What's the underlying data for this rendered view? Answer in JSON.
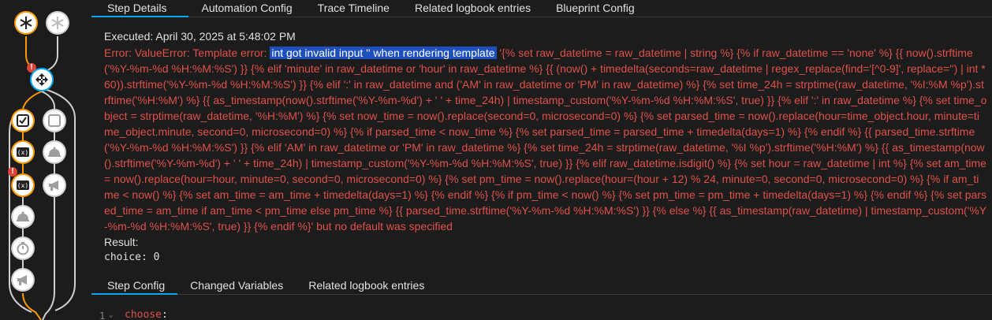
{
  "tabs_top": [
    {
      "label": "Step Details",
      "active": true
    },
    {
      "label": "Automation Config",
      "active": false
    },
    {
      "label": "Trace Timeline",
      "active": false
    },
    {
      "label": "Related logbook entries",
      "active": false
    },
    {
      "label": "Blueprint Config",
      "active": false
    }
  ],
  "details": {
    "executed": "Executed: April 30, 2025 at 5:48:02 PM",
    "error_prefix": "Error: ValueError: Template error: ",
    "error_highlight": "int got invalid input '' when rendering template",
    "error_rest": " '{% set raw_datetime = raw_datetime | string %} {% if raw_datetime == 'none' %} {{ now().strftime('%Y-%m-%d %H:%M:%S') }} {% elif 'minute' in raw_datetime or 'hour' in raw_datetime %} {{ (now() + timedelta(seconds=raw_datetime | regex_replace(find='[^0-9]', replace='') | int * 60)).strftime('%Y-%m-%d %H:%M:%S') }} {% elif ':' in raw_datetime and ('AM' in raw_datetime or 'PM' in raw_datetime) %} {% set time_24h = strptime(raw_datetime, '%I:%M %p').strftime('%H:%M') %} {{ as_timestamp(now().strftime('%Y-%m-%d') + ' ' + time_24h) | timestamp_custom('%Y-%m-%d %H:%M:%S', true) }} {% elif ':' in raw_datetime %} {% set time_object = strptime(raw_datetime, '%H:%M') %} {% set now_time = now().replace(second=0, microsecond=0) %} {% set parsed_time = now().replace(hour=time_object.hour, minute=time_object.minute, second=0, microsecond=0) %} {% if parsed_time < now_time %} {% set parsed_time = parsed_time + timedelta(days=1) %} {% endif %} {{ parsed_time.strftime('%Y-%m-%d %H:%M:%S') }} {% elif 'AM' in raw_datetime or 'PM' in raw_datetime %} {% set time_24h = strptime(raw_datetime, '%I %p').strftime('%H:%M') %} {{ as_timestamp(now().strftime('%Y-%m-%d') + ' ' + time_24h) | timestamp_custom('%Y-%m-%d %H:%M:%S', true) }} {% elif raw_datetime.isdigit() %} {% set hour = raw_datetime | int %} {% set am_time = now().replace(hour=hour, minute=0, second=0, microsecond=0) %} {% set pm_time = now().replace(hour=(hour + 12) % 24, minute=0, second=0, microsecond=0) %} {% if am_time < now() %} {% set am_time = am_time + timedelta(days=1) %} {% endif %} {% if pm_time < now() %} {% set pm_time = pm_time + timedelta(days=1) %} {% endif %} {% set parsed_time = am_time if am_time < pm_time else pm_time %} {{ parsed_time.strftime('%Y-%m-%d %H:%M:%S') }} {% else %} {{ as_timestamp(raw_datetime) | timestamp_custom('%Y-%m-%d %H:%M:%S', true) }} {% endif %}' but no default was specified",
    "result_label": "Result:",
    "result_value": "choice: 0"
  },
  "tabs_bottom": [
    {
      "label": "Step Config",
      "active": true
    },
    {
      "label": "Changed Variables",
      "active": false
    },
    {
      "label": "Related logbook entries",
      "active": false
    }
  ],
  "editor": {
    "line_number": "1",
    "code_key": "choose",
    "code_colon": ":"
  },
  "graph": {
    "badge_text": "!",
    "colors": {
      "active": "#ff9800",
      "inactive": "#cfcfcf",
      "error": "#db4437",
      "selected": "#03a9f4"
    },
    "nodes": [
      {
        "icon": "asterisk-icon",
        "state": "active"
      },
      {
        "icon": "asterisk-icon",
        "state": "inactive"
      },
      {
        "icon": "shuffle-icon",
        "state": "selected"
      },
      {
        "icon": "checkbox-checked-icon",
        "state": "active"
      },
      {
        "icon": "checkbox-empty-icon",
        "state": "inactive"
      },
      {
        "icon": "variable-icon",
        "state": "active"
      },
      {
        "icon": "bell-icon",
        "state": "inactive"
      },
      {
        "icon": "variable-icon",
        "state": "active"
      },
      {
        "icon": "megaphone-icon",
        "state": "inactive"
      },
      {
        "icon": "bell-icon",
        "state": "inactive"
      },
      {
        "icon": "timer-icon",
        "state": "inactive"
      },
      {
        "icon": "megaphone-icon",
        "state": "inactive"
      }
    ]
  }
}
